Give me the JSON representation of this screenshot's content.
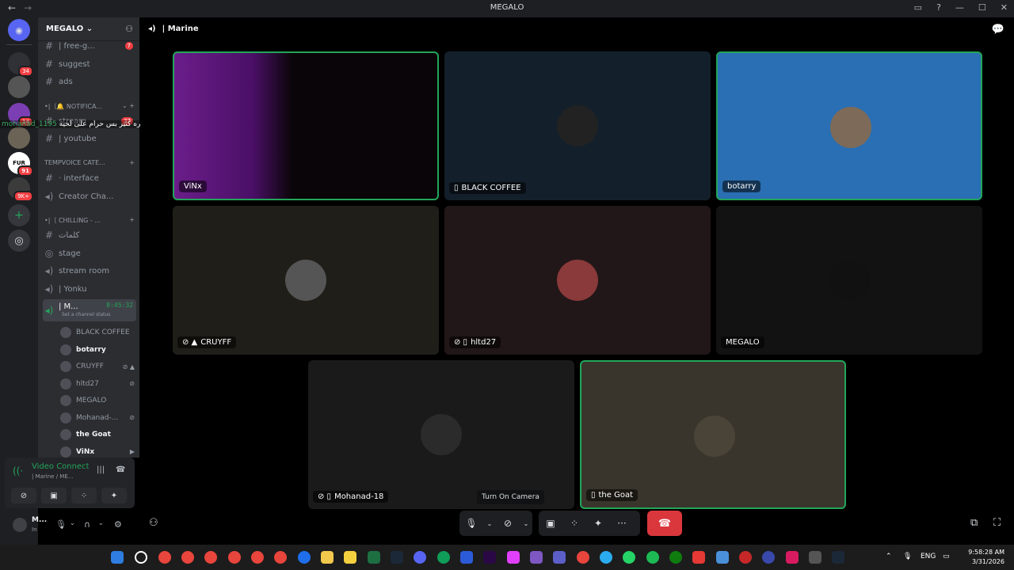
{
  "window": {
    "title": "MEGALO"
  },
  "server": {
    "name": "MEGALO"
  },
  "guild_badges": [
    "34",
    "14",
    "91",
    "9K+"
  ],
  "channels": {
    "free_games": {
      "label": "| free-g...",
      "badge": "7"
    },
    "suggest": "suggest",
    "ads": "ads",
    "cat_notifications": "•|〔🔔 NOTIFICA...",
    "stream": {
      "label": "stream",
      "badge": "27"
    },
    "youtube": "| youtube",
    "cat_tempvoice": "TEMPVOICE CATE...",
    "interface": "· interface",
    "creator": "Creator Cha...",
    "cat_chilling": "•|〔 CHILLING - ...",
    "words": "كلمات",
    "stage": "stage",
    "stream_room": "stream room",
    "yonku": "| Yonku",
    "active": {
      "label": "| M...",
      "time": "8:45:32",
      "status": "Set a channel status"
    }
  },
  "overlay_msg": {
    "user": "mohanad_1195",
    "text": "مو مره كثير بس حرام على لحيه :"
  },
  "voice_users": [
    {
      "name": "BLACK COFFEE",
      "icon": "",
      "bold": false
    },
    {
      "name": "botarry",
      "icon": "",
      "bold": true
    },
    {
      "name": "CRUYFF",
      "icon": "⊘ ▲",
      "bold": false
    },
    {
      "name": "hltd27",
      "icon": "⊘",
      "bold": false
    },
    {
      "name": "MEGALO",
      "icon": "",
      "bold": false
    },
    {
      "name": "Mohanad-...",
      "icon": "⊘",
      "bold": false
    },
    {
      "name": "the Goat",
      "icon": "",
      "bold": true
    },
    {
      "name": "ViNx",
      "icon": "▶",
      "bold": true
    }
  ],
  "voice_panel": {
    "title": "Video Connected",
    "subtitle": "| Marine / ME..."
  },
  "user_panel": {
    "name": "M...",
    "status": "In"
  },
  "stage": {
    "channel": "| Marine",
    "tooltip": "Turn On Camera"
  },
  "tiles": [
    {
      "name": "ViNx",
      "prefix": "",
      "bg": "#0a0508"
    },
    {
      "name": "BLACK COFFEE",
      "prefix": "▯",
      "bg": "#13202b"
    },
    {
      "name": "botarry",
      "prefix": "",
      "bg": "#2a6fb3"
    },
    {
      "name": "CRUYFF",
      "prefix": "⊘ ▲",
      "bg": "#1f1e18"
    },
    {
      "name": "hltd27",
      "prefix": "⊘ ▯",
      "bg": "#221718"
    },
    {
      "name": "MEGALO",
      "prefix": "",
      "bg": "#121212"
    },
    {
      "name": "Mohanad-18",
      "prefix": "⊘ ▯",
      "bg": "#1a1a1a"
    },
    {
      "name": "the Goat",
      "prefix": "▯",
      "bg": "#3a352c"
    }
  ],
  "taskbar": {
    "lang": "ENG",
    "time": "9:58:28 AM",
    "date": "3/31/2026"
  }
}
